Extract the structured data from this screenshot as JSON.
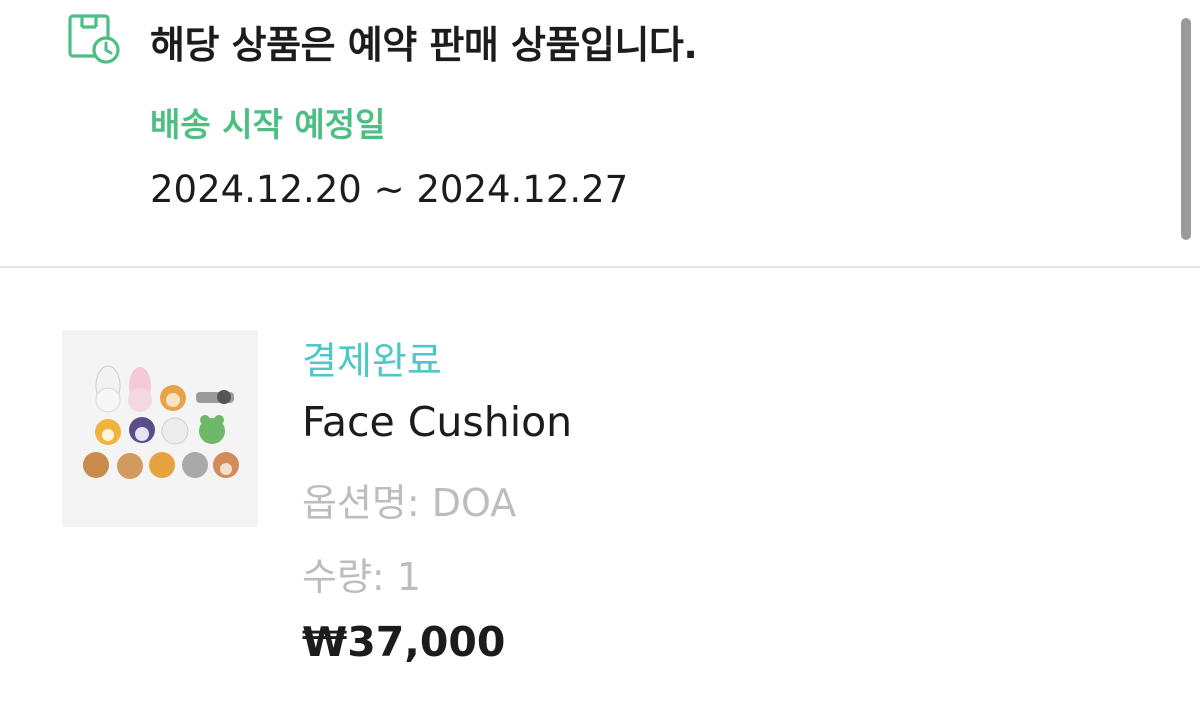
{
  "notice": {
    "icon": "calendar-clock-icon",
    "title": "해당 상품은 예약 판매 상품입니다.",
    "shipping_label": "배송 시작 예정일",
    "shipping_range": "2024.12.20 ~ 2024.12.27"
  },
  "order": {
    "status": "결제완료",
    "product_name": "Face Cushion",
    "option_label": "옵션명:",
    "option_value": "DOA",
    "quantity_label": "수량:",
    "quantity_value": "1",
    "price": "₩37,000"
  },
  "colors": {
    "accent_green": "#4cbf83",
    "status_teal": "#4fc7c9",
    "muted_gray": "#bdbdbd",
    "text_dark": "#1c1c1c"
  }
}
